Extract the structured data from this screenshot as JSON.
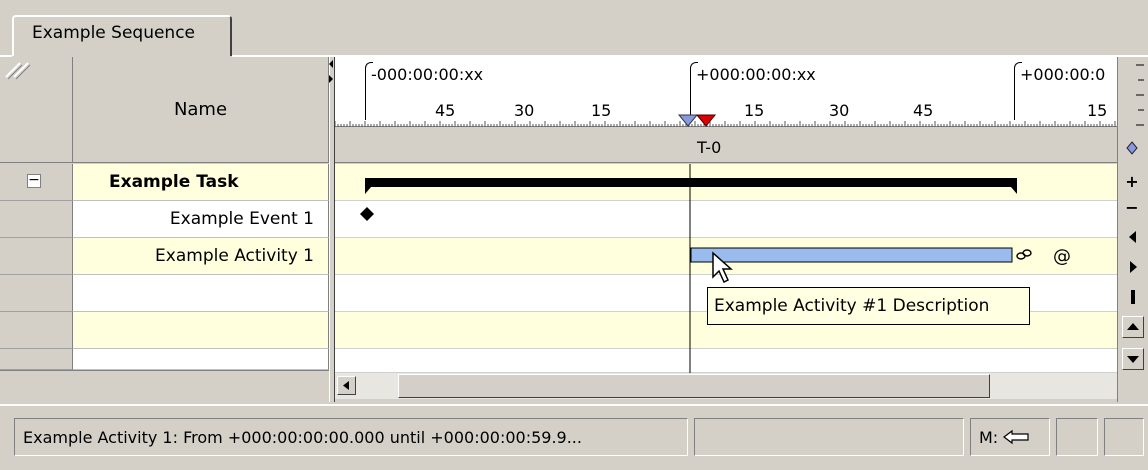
{
  "tab": {
    "label": "Example Sequence"
  },
  "table": {
    "name_header": "Name",
    "rows": [
      {
        "name": "Example Task"
      },
      {
        "name": "Example Event 1"
      },
      {
        "name": "Example Activity 1"
      },
      {
        "name": ""
      },
      {
        "name": ""
      },
      {
        "name": ""
      }
    ]
  },
  "ruler": {
    "segment_labels": [
      "-000:00:00:xx",
      "+000:00:00:xx",
      "+000:00:0"
    ],
    "tick_labels": [
      "45",
      "30",
      "15",
      "15",
      "30",
      "45",
      "15"
    ],
    "t0_label": "T-0"
  },
  "gantt": {
    "resource_marker": "@",
    "task_progress": 1.0,
    "activity_progress": 1.0
  },
  "tooltip": {
    "text": "Example Activity #1 Description"
  },
  "status": {
    "message": "Example Activity 1: From +000:00:00:00.000 until +000:00:00:59.9...",
    "mode_label": "M:"
  },
  "colors": {
    "yellow_row": "#ffffdd",
    "activity_bar": "#99bbee",
    "marker_blue": "#8899dd",
    "marker_red": "#dd0000"
  }
}
